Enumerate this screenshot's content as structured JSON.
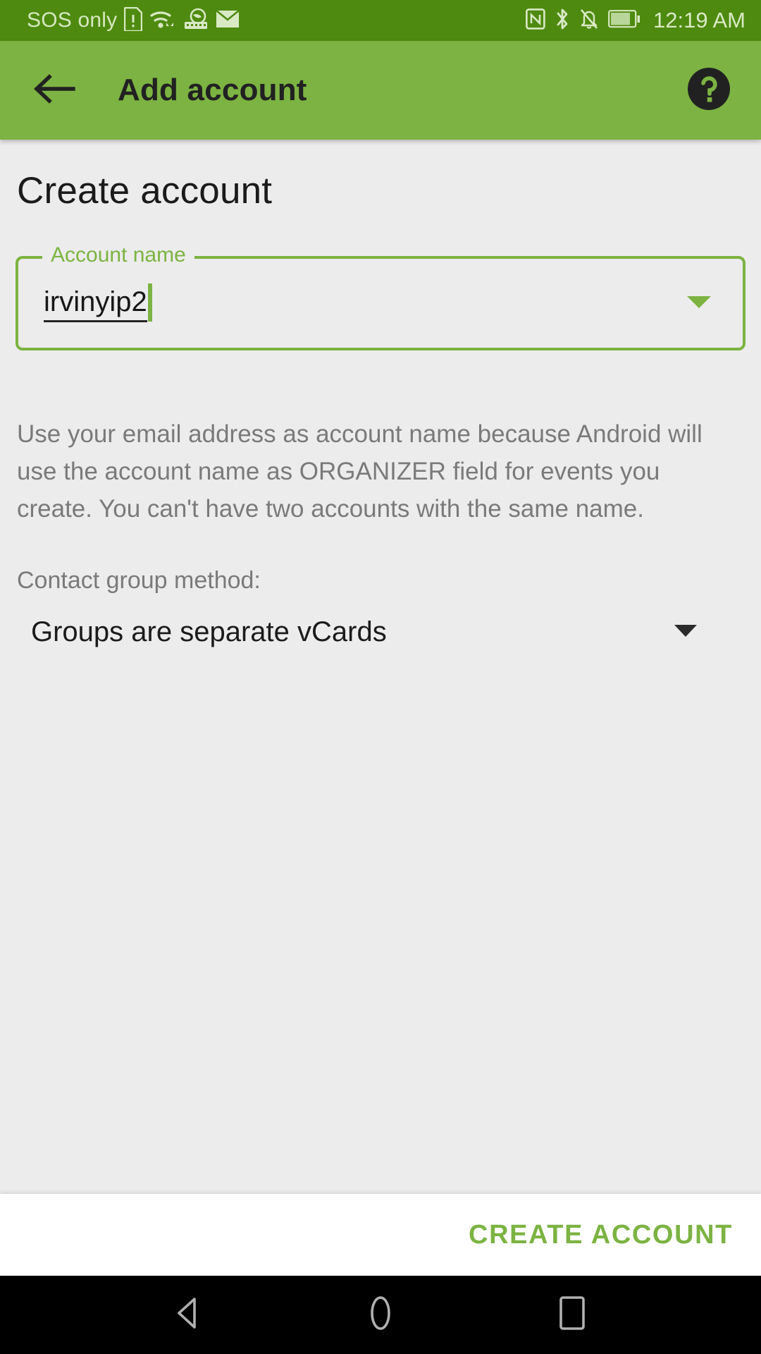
{
  "status_bar": {
    "carrier": "SOS only",
    "clock": "12:19 AM",
    "background": "#4e8a0f",
    "foreground": "#d9e9c4",
    "left_icons": [
      "sim-alert-icon",
      "wifi-icon",
      "vpn-key-icon",
      "email-icon"
    ],
    "right_icons": [
      "nfc-icon",
      "bluetooth-icon",
      "notifications-off-icon",
      "battery-icon"
    ]
  },
  "app_bar": {
    "title": "Add account",
    "back_icon": "arrow-back-icon",
    "help_icon": "help-circle-icon",
    "background": "#7cb342",
    "title_color": "#212121"
  },
  "content": {
    "page_title": "Create account",
    "account_name_field": {
      "label": "Account name",
      "value": "irvinyip2",
      "placeholder": "",
      "dropdown_icon": "chevron-down-icon",
      "accent": "#7cb342",
      "focused": true
    },
    "description": "Use your email address as account name because Android will use the account name as ORGANIZER field for events you create. You can't have two accounts with the same name.",
    "contact_group_method": {
      "label": "Contact group method:",
      "selected": "Groups are separate vCards",
      "dropdown_icon": "chevron-down-icon"
    }
  },
  "action_bar": {
    "create_label": "CREATE ACCOUNT",
    "accent": "#7cb342"
  },
  "nav_bar": {
    "back": "nav-back-icon",
    "home": "nav-home-icon",
    "recents": "nav-recents-icon",
    "background": "#000000"
  }
}
